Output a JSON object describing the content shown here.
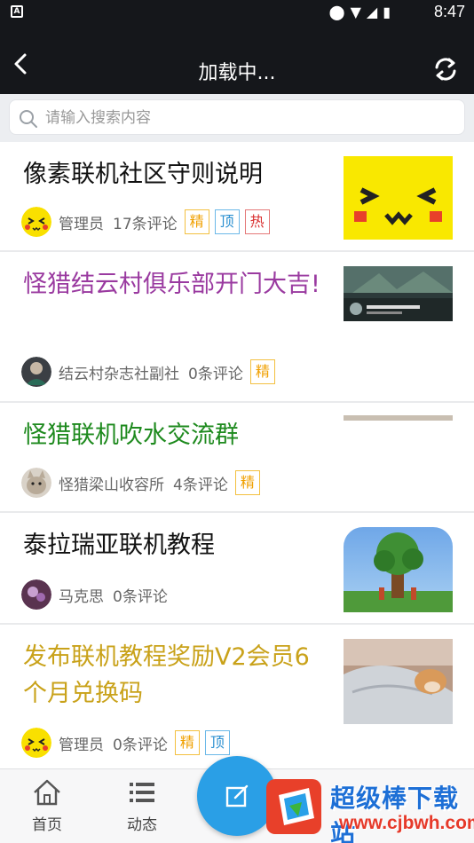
{
  "status_bar": {
    "time": "8:47",
    "app_badge": "A"
  },
  "header": {
    "title": "加载中..."
  },
  "search": {
    "placeholder": "请输入搜索内容"
  },
  "posts": [
    {
      "title": "像素联机社区守则说明",
      "title_color": "#111111",
      "author": "管理员",
      "comments": "17条评论",
      "badges": [
        "精",
        "顶",
        "热"
      ]
    },
    {
      "title": "怪猎结云村俱乐部开门大吉!",
      "title_color": "#9a3aa0",
      "author": "结云村杂志社副社",
      "comments": "0条评论",
      "badges": [
        "精"
      ]
    },
    {
      "title": "怪猎联机吹水交流群",
      "title_color": "#1e8a1e",
      "author": "怪猎梁山收容所",
      "comments": "4条评论",
      "badges": [
        "精"
      ]
    },
    {
      "title": "泰拉瑞亚联机教程",
      "title_color": "#111111",
      "author": "马克思",
      "comments": "0条评论",
      "badges": []
    },
    {
      "title": "发布联机教程奖励V2会员6个月兑换码",
      "title_color": "#c9a21a",
      "author": "管理员",
      "comments": "0条评论",
      "badges": [
        "精",
        "顶"
      ]
    }
  ],
  "tabbar": {
    "home": "首页",
    "feed": "动态",
    "fab_icon": "edit-icon"
  },
  "watermark": {
    "name": "超级棒下载站",
    "url": "www.cjbwh.com"
  }
}
